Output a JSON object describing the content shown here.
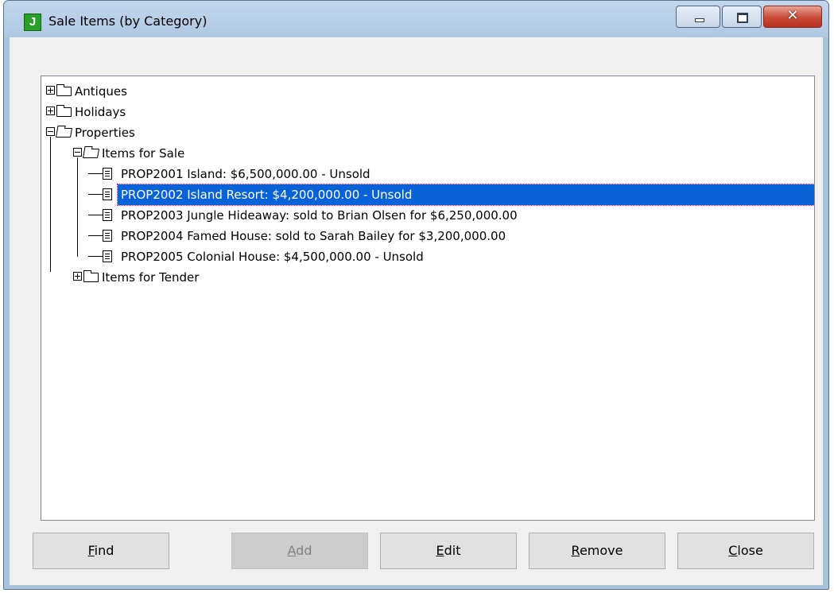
{
  "window": {
    "title": "Sale Items (by Category)",
    "app_icon_letter": "J",
    "controls": {
      "minimize": "minimize",
      "maximize": "maximize",
      "close": "✕"
    }
  },
  "tree": {
    "items": [
      {
        "label": "Antiques",
        "type": "folder",
        "state": "collapsed",
        "level": 0
      },
      {
        "label": "Holidays",
        "type": "folder",
        "state": "collapsed",
        "level": 0
      },
      {
        "label": "Properties",
        "type": "folder",
        "state": "expanded",
        "level": 0
      },
      {
        "label": "Items for Sale",
        "type": "folder",
        "state": "expanded",
        "level": 1
      },
      {
        "label": "PROP2001 Island: $6,500,000.00 - Unsold",
        "type": "item",
        "level": 2
      },
      {
        "label": "PROP2002 Island Resort: $4,200,000.00 - Unsold",
        "type": "item",
        "level": 2,
        "selected": true
      },
      {
        "label": "PROP2003 Jungle Hideaway: sold to Brian Olsen for $6,250,000.00",
        "type": "item",
        "level": 2
      },
      {
        "label": "PROP2004 Famed House: sold to Sarah Bailey for $3,200,000.00",
        "type": "item",
        "level": 2
      },
      {
        "label": "PROP2005 Colonial House: $4,500,000.00 - Unsold",
        "type": "item",
        "level": 2
      },
      {
        "label": "Items for Tender",
        "type": "folder",
        "state": "collapsed",
        "level": 1
      }
    ]
  },
  "buttons": {
    "find": {
      "mnemonic": "F",
      "rest": "ind",
      "enabled": true
    },
    "add": {
      "mnemonic": "A",
      "rest": "dd",
      "enabled": false
    },
    "edit": {
      "mnemonic": "E",
      "rest": "dit",
      "enabled": true
    },
    "remove": {
      "mnemonic": "R",
      "rest": "emove",
      "enabled": true
    },
    "close": {
      "mnemonic": "C",
      "rest": "lose",
      "enabled": true
    }
  },
  "colors": {
    "selection": "#0a62d8",
    "titlebar": "#aec7e2",
    "close_button": "#c94a38"
  }
}
